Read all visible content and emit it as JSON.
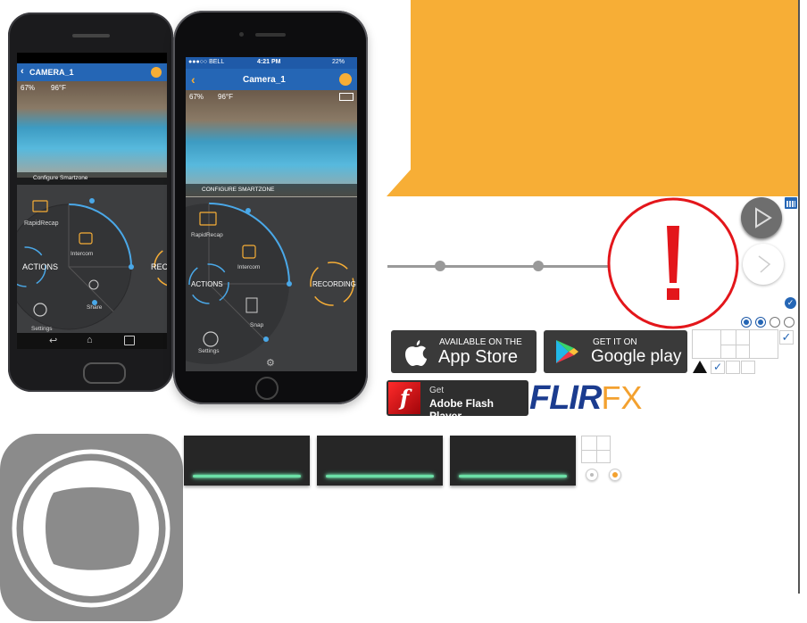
{
  "android_phone": {
    "camera_title": "CAMERA_1",
    "humidity": "67%",
    "temperature": "96°F",
    "configure_label": "Configure Smartzone",
    "menu": {
      "rapidrecap": "RapidRecap",
      "intercom": "Intercom",
      "actions": "ACTIONS",
      "recording": "RECOR",
      "share": "Share",
      "settings": "Settings"
    }
  },
  "iphone": {
    "status": {
      "carrier": "●●●○○ BELL",
      "time": "4:21 PM",
      "battery": "22%"
    },
    "camera_title": "Camera_1",
    "humidity": "67%",
    "temperature": "96°F",
    "configure_label": "CONFIGURE SMARTZONE",
    "menu": {
      "rapidrecap": "RapidRecap",
      "intercom": "Intercom",
      "actions": "ACTIONS",
      "recording": "RECORDING",
      "snap": "Snap",
      "settings": "Settings"
    }
  },
  "stores": {
    "app_store": {
      "small": "AVAILABLE ON THE",
      "big": "App Store"
    },
    "google_play": {
      "small": "GET IT ON",
      "big": "Google play"
    },
    "flash": {
      "small": "Get",
      "big": "Adobe Flash Player"
    }
  },
  "brand": {
    "flir": "FLIR",
    "fx": "FX"
  },
  "alert_icon": "exclamation-icon",
  "colors": {
    "orange": "#F7AE36",
    "blue": "#2566B5",
    "alert_red": "#E3161B",
    "glow_green": "#6BE0A6",
    "flir_blue": "#1B3C8F",
    "fx_orange": "#F3A12F"
  }
}
